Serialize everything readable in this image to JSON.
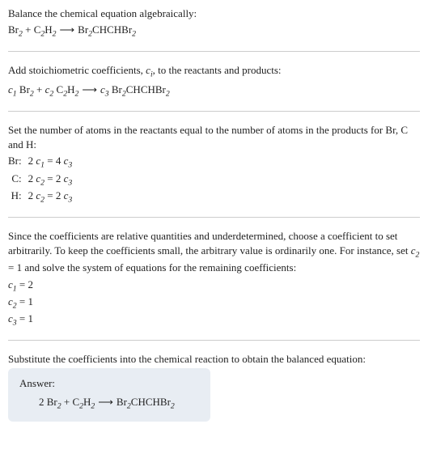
{
  "section1": {
    "intro": "Balance the chemical equation algebraically:",
    "lhs1": "Br",
    "lhs1sub": "2",
    "plus": " + ",
    "lhs2a": "C",
    "lhs2asub": "2",
    "lhs2b": "H",
    "lhs2bsub": "2",
    "arrow": "⟶",
    "rhs1": "Br",
    "rhs1sub": "2",
    "rhs2": "CHCHBr",
    "rhs2sub": "2"
  },
  "section2": {
    "intro_a": "Add stoichiometric coefficients, ",
    "intro_ci": "c",
    "intro_ci_sub": "i",
    "intro_b": ", to the reactants and products:",
    "c1": "c",
    "c1sub": "1",
    "sp": " ",
    "lhs1": "Br",
    "lhs1sub": "2",
    "plus": " + ",
    "c2": "c",
    "c2sub": "2",
    "lhs2a": "C",
    "lhs2asub": "2",
    "lhs2b": "H",
    "lhs2bsub": "2",
    "arrow": "⟶",
    "c3": "c",
    "c3sub": "3",
    "rhs1": "Br",
    "rhs1sub": "2",
    "rhs2": "CHCHBr",
    "rhs2sub": "2"
  },
  "section3": {
    "intro": "Set the number of atoms in the reactants equal to the number of atoms in the products for Br, C and H:",
    "rows": [
      {
        "label": "Br:",
        "lhs_coef": "2 ",
        "lhs_c": "c",
        "lhs_sub": "1",
        "eq": " = ",
        "rhs_coef": "4 ",
        "rhs_c": "c",
        "rhs_sub": "3"
      },
      {
        "label": "C:",
        "lhs_coef": "2 ",
        "lhs_c": "c",
        "lhs_sub": "2",
        "eq": " = ",
        "rhs_coef": "2 ",
        "rhs_c": "c",
        "rhs_sub": "3"
      },
      {
        "label": "H:",
        "lhs_coef": "2 ",
        "lhs_c": "c",
        "lhs_sub": "2",
        "eq": " = ",
        "rhs_coef": "2 ",
        "rhs_c": "c",
        "rhs_sub": "3"
      }
    ]
  },
  "section4": {
    "intro_a": "Since the coefficients are relative quantities and underdetermined, choose a coefficient to set arbitrarily. To keep the coefficients small, the arbitrary value is ordinarily one. For instance, set ",
    "intro_c": "c",
    "intro_csub": "2",
    "intro_b": " = 1 and solve the system of equations for the remaining coefficients:",
    "lines": [
      {
        "c": "c",
        "csub": "1",
        "rest": " = 2"
      },
      {
        "c": "c",
        "csub": "2",
        "rest": " = 1"
      },
      {
        "c": "c",
        "csub": "3",
        "rest": " = 1"
      }
    ]
  },
  "section5": {
    "intro": "Substitute the coefficients into the chemical reaction to obtain the balanced equation:",
    "answer_label": "Answer:",
    "coef": "2 ",
    "lhs1": "Br",
    "lhs1sub": "2",
    "plus": " + ",
    "lhs2a": "C",
    "lhs2asub": "2",
    "lhs2b": "H",
    "lhs2bsub": "2",
    "arrow": "⟶",
    "rhs1": "Br",
    "rhs1sub": "2",
    "rhs2": "CHCHBr",
    "rhs2sub": "2"
  }
}
